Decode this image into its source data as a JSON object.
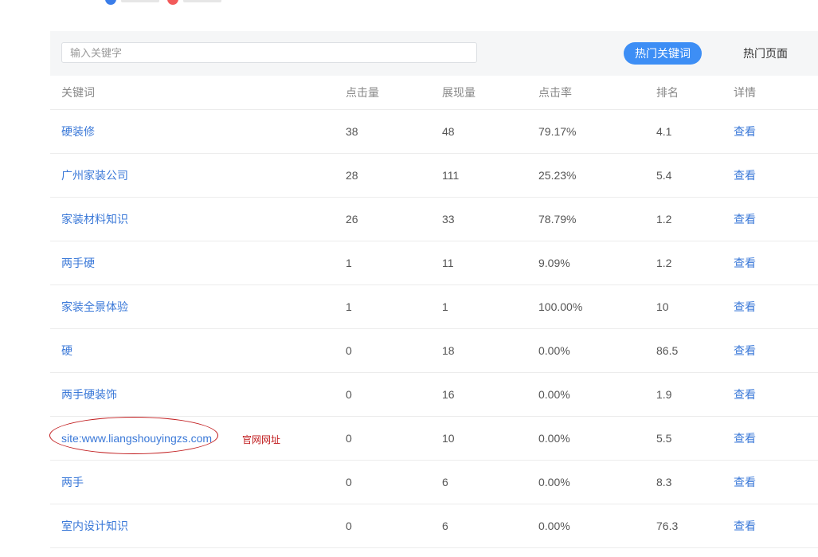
{
  "legend": {
    "colors": [
      "#3a7de9",
      "#f25a5a"
    ]
  },
  "toolbar": {
    "search_placeholder": "输入关键字",
    "hot_keywords_label": "热门关键词",
    "hot_pages_label": "热门页面"
  },
  "table": {
    "headers": [
      "关键词",
      "点击量",
      "展现量",
      "点击率",
      "排名",
      "详情"
    ],
    "rows": [
      {
        "keyword": "硬装修",
        "clicks": "38",
        "impressions": "48",
        "ctr": "79.17%",
        "rank": "4.1",
        "detail": "查看"
      },
      {
        "keyword": "广州家装公司",
        "clicks": "28",
        "impressions": "111",
        "ctr": "25.23%",
        "rank": "5.4",
        "detail": "查看"
      },
      {
        "keyword": "家装材料知识",
        "clicks": "26",
        "impressions": "33",
        "ctr": "78.79%",
        "rank": "1.2",
        "detail": "查看"
      },
      {
        "keyword": "两手硬",
        "clicks": "1",
        "impressions": "11",
        "ctr": "9.09%",
        "rank": "1.2",
        "detail": "查看"
      },
      {
        "keyword": "家装全景体验",
        "clicks": "1",
        "impressions": "1",
        "ctr": "100.00%",
        "rank": "10",
        "detail": "查看"
      },
      {
        "keyword": "硬",
        "clicks": "0",
        "impressions": "18",
        "ctr": "0.00%",
        "rank": "86.5",
        "detail": "查看"
      },
      {
        "keyword": "两手硬装饰",
        "clicks": "0",
        "impressions": "16",
        "ctr": "0.00%",
        "rank": "1.9",
        "detail": "查看"
      },
      {
        "keyword": "site:www.liangshouyingzs.com",
        "clicks": "0",
        "impressions": "10",
        "ctr": "0.00%",
        "rank": "5.5",
        "detail": "查看"
      },
      {
        "keyword": "两手",
        "clicks": "0",
        "impressions": "6",
        "ctr": "0.00%",
        "rank": "8.3",
        "detail": "查看"
      },
      {
        "keyword": "室内设计知识",
        "clicks": "0",
        "impressions": "6",
        "ctr": "0.00%",
        "rank": "76.3",
        "detail": "查看"
      }
    ]
  },
  "annotation": {
    "note": "官网网址",
    "color": "#c0191b"
  },
  "colors": {
    "accent": "#3d8ef5",
    "link": "#3b79d8"
  }
}
